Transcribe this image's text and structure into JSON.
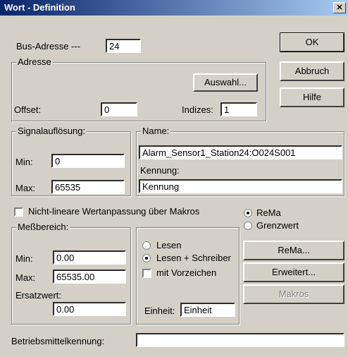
{
  "window": {
    "title": "Wort - Definition",
    "close": "✕"
  },
  "bus": {
    "label": "Bus-Adresse ---",
    "value": "24"
  },
  "adresse": {
    "title": "Adresse",
    "auswahl_button": "Auswahl...",
    "offset_label": "Offset:",
    "offset_value": "0",
    "indizes_label": "Indizes:",
    "indizes_value": "1"
  },
  "buttons": {
    "ok": "OK",
    "abbruch": "Abbruch",
    "hilfe": "Hilfe"
  },
  "signal": {
    "title": "Signalauflösung:",
    "min_label": "Min:",
    "min_value": "0",
    "max_label": "Max:",
    "max_value": "65535"
  },
  "name_group": {
    "title": "Name:",
    "name_value": "Alarm_Sensor1_Station24:O024S001",
    "kennung_label": "Kennung:",
    "kennung_value": "Kennung"
  },
  "nonlinear": {
    "label": "Nicht-lineare Wertanpassung über Makros",
    "checked": false
  },
  "mode_radios": {
    "rema": "ReMa",
    "grenzwert": "Grenzwert",
    "selected": "rema"
  },
  "messbereich": {
    "title": "Meßbereich:",
    "min_label": "Min:",
    "min_value": "0.00",
    "max_label": "Max:",
    "max_value": "65535.00",
    "ersatz_label": "Ersatzwert:",
    "ersatz_value": "0.00"
  },
  "access": {
    "lesen": "Lesen",
    "lesen_schreiben": "Lesen + Schreiber",
    "selected": "lesen_schreiben",
    "vorzeichen": "mit Vorzeichen",
    "vorzeichen_checked": false,
    "einheit_label": "Einheit:",
    "einheit_value": "Einheit"
  },
  "side_buttons": {
    "rema": "ReMa...",
    "erweitert": "Erweitert...",
    "makros": "Makros"
  },
  "betrieb": {
    "label": "Betriebsmittelkennung:",
    "value": ""
  }
}
